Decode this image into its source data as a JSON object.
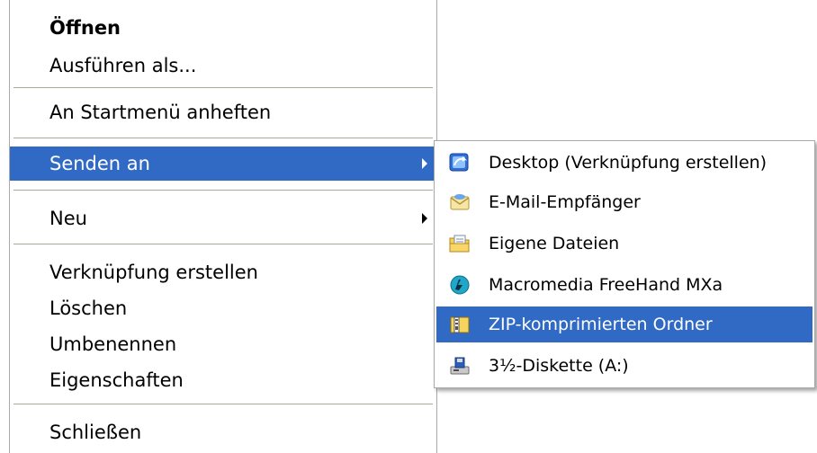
{
  "context_menu": {
    "items": [
      {
        "label": "Öffnen"
      },
      {
        "label": "Ausführen als..."
      },
      {
        "label": "An Startmenü anheften"
      },
      {
        "label": "Senden an"
      },
      {
        "label": "Neu"
      },
      {
        "label": "Verknüpfung erstellen"
      },
      {
        "label": "Löschen"
      },
      {
        "label": "Umbenennen"
      },
      {
        "label": "Eigenschaften"
      },
      {
        "label": "Schließen"
      }
    ],
    "selected_item": "Senden an"
  },
  "send_to_submenu": {
    "items": [
      {
        "label": "Desktop (Verknüpfung erstellen)",
        "icon": "desktop-shortcut-icon"
      },
      {
        "label": "E-Mail-Empfänger",
        "icon": "mail-envelope-icon"
      },
      {
        "label": "Eigene Dateien",
        "icon": "my-documents-folder-icon"
      },
      {
        "label": "Macromedia FreeHand MXa",
        "icon": "freehand-app-icon"
      },
      {
        "label": "ZIP-komprimierten Ordner",
        "icon": "zip-folder-icon"
      },
      {
        "label": "3½-Diskette (A:)",
        "icon": "floppy-drive-icon"
      }
    ],
    "selected_item": "ZIP-komprimierten Ordner"
  },
  "colors": {
    "selection": "#316ac5",
    "selection_text": "#ffffff",
    "menu_background": "#ffffff",
    "separator": "#aca899"
  }
}
